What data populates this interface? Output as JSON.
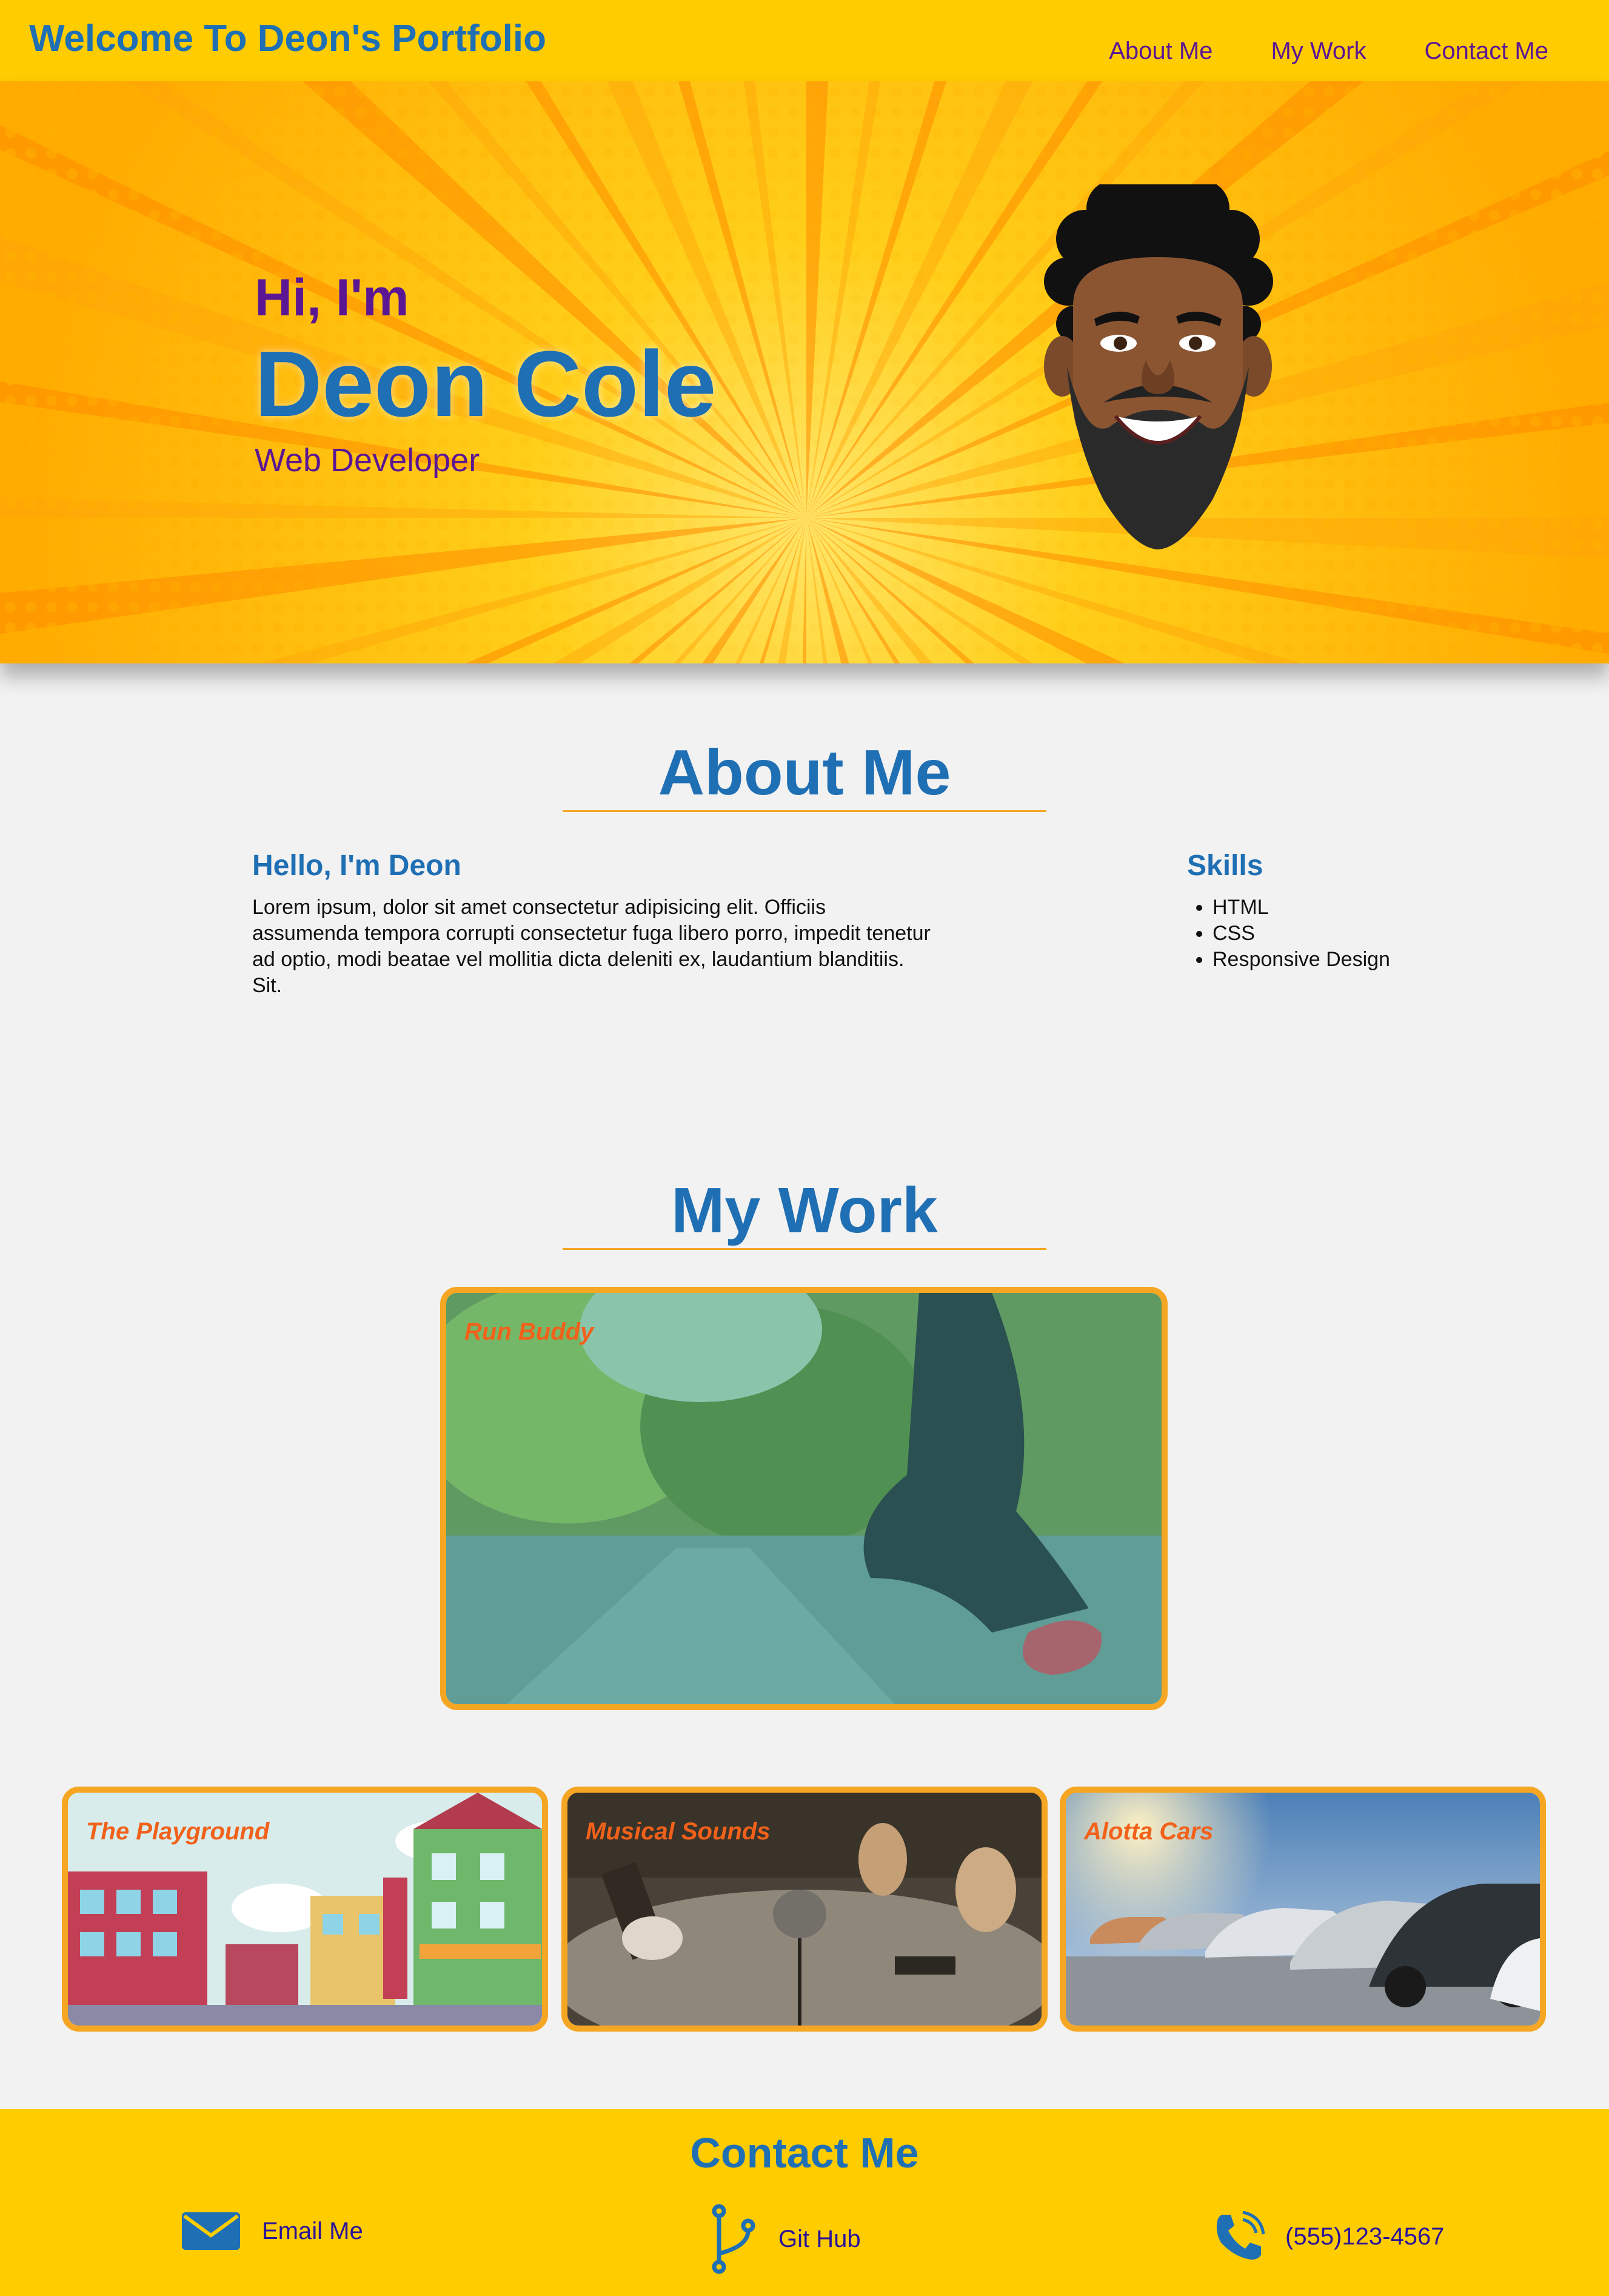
{
  "header": {
    "title": "Welcome To Deon's Portfolio",
    "nav": [
      "About Me",
      "My Work",
      "Contact Me"
    ]
  },
  "hero": {
    "greeting": "Hi, I'm",
    "name": "Deon Cole",
    "role": "Web Developer"
  },
  "about": {
    "heading": "About Me",
    "subheading": "Hello, I'm Deon",
    "body": "Lorem ipsum, dolor sit amet consectetur adipisicing elit. Officiis assumenda tempora corrupti consectetur fuga libero porro, impedit tenetur ad optio, modi beatae vel mollitia dicta deleniti ex, laudantium blanditiis. Sit.",
    "skills_heading": "Skills",
    "skills": [
      "HTML",
      "CSS",
      "Responsive Design"
    ]
  },
  "work": {
    "heading": "My Work",
    "projects": [
      "Run Buddy",
      "The Playground",
      "Musical Sounds",
      "Alotta Cars"
    ]
  },
  "contact": {
    "heading": "Contact Me",
    "email_label": "Email Me",
    "github_label": "Git Hub",
    "phone": "(555)123-4567"
  },
  "colors": {
    "header_bg": "#ffcc00",
    "brand_blue": "#1f6fb4",
    "accent_purple": "#5b1694",
    "card_border": "#f5a623",
    "card_label": "#f2611a"
  },
  "icons": [
    "envelope-icon",
    "git-branch-icon",
    "phone-icon"
  ]
}
